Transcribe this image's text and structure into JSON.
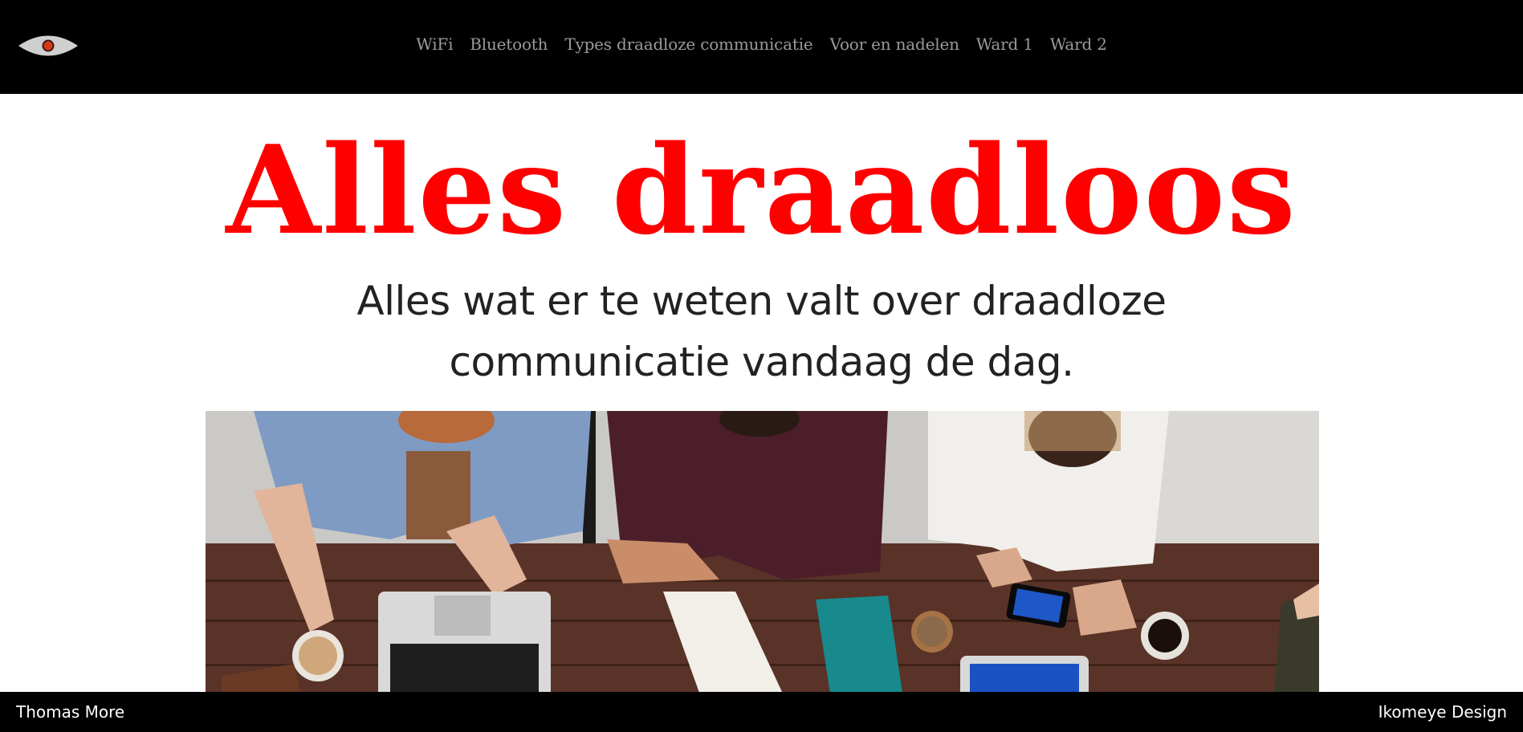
{
  "nav": {
    "logo": "eye-icon",
    "links": [
      {
        "label": "WiFi"
      },
      {
        "label": "Bluetooth"
      },
      {
        "label": "Types draadloze communicatie"
      },
      {
        "label": "Voor en nadelen"
      },
      {
        "label": "Ward 1"
      },
      {
        "label": "Ward 2"
      }
    ]
  },
  "hero": {
    "title": "Alles draadloos",
    "subtitle": "Alles wat er te weten valt over draadloze communicatie vandaag de dag."
  },
  "footer": {
    "left": "Thomas More",
    "right": "Ikomeye Design"
  },
  "colors": {
    "nav_background": "#000000",
    "nav_link": "#9a9a9a",
    "title": "#ff0000",
    "subtitle": "#222222",
    "footer_background": "#000000",
    "footer_text": "#ffffff"
  }
}
